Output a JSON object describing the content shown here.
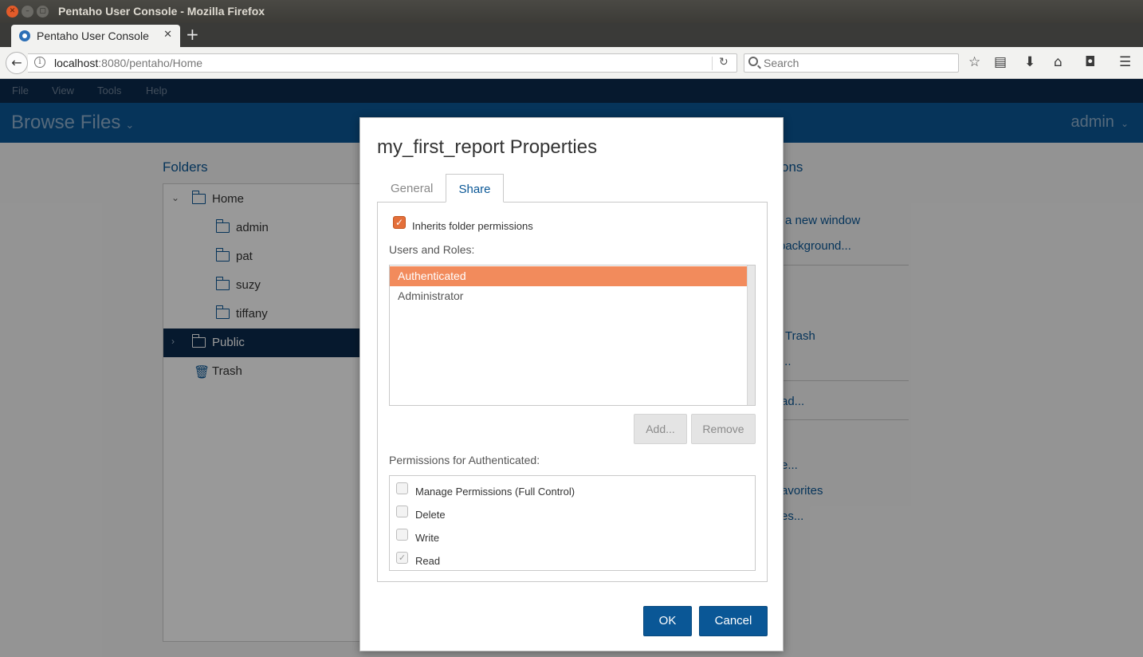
{
  "window": {
    "title": "Pentaho User Console - Mozilla Firefox",
    "close_glyph": "✕",
    "min_glyph": "–",
    "max_glyph": "▢"
  },
  "browser": {
    "tab_title": "Pentaho User Console",
    "tab_close": "✕",
    "new_tab": "+",
    "url_host": "localhost",
    "url_rest": ":8080/pentaho/Home",
    "search_placeholder": "Search",
    "back_glyph": "←",
    "reload_glyph": "↻",
    "info_glyph": "i",
    "toolbar_icons": {
      "bookmark": "☆",
      "reading_list": "▤",
      "download": "⬇",
      "home": "⌂",
      "pocket": "◘",
      "menu": "☰"
    }
  },
  "app": {
    "menu": [
      "File",
      "View",
      "Tools",
      "Help"
    ],
    "perspective": "Browse Files",
    "chevron": "⌄",
    "user": "admin"
  },
  "folders": {
    "title": "Folders",
    "items": [
      {
        "label": "Home",
        "toggle": "⌄"
      },
      {
        "label": "admin"
      },
      {
        "label": "pat"
      },
      {
        "label": "suzy"
      },
      {
        "label": "tiffany"
      },
      {
        "label": "Public",
        "toggle": "›"
      },
      {
        "label": "Trash",
        "icon": "🗑"
      }
    ]
  },
  "actions_bg": {
    "title": "ons",
    "links": [
      "a new window",
      "background...",
      "Trash",
      "...",
      "ad...",
      "e...",
      "avorites",
      "es..."
    ]
  },
  "dialog": {
    "title": "my_first_report Properties",
    "tabs": [
      "General",
      "Share"
    ],
    "inherit_label": "Inherits folder permissions",
    "inherit_checked": true,
    "check_glyph": "✓",
    "users_label": "Users and Roles:",
    "users": [
      "Authenticated",
      "Administrator"
    ],
    "selected_user": "Authenticated",
    "add_button": "Add...",
    "remove_button": "Remove",
    "permissions_label": "Permissions for Authenticated:",
    "permissions": [
      {
        "label": "Manage Permissions (Full Control)",
        "checked": false
      },
      {
        "label": "Delete",
        "checked": false
      },
      {
        "label": "Write",
        "checked": false
      },
      {
        "label": "Read",
        "checked": true
      }
    ],
    "ok_button": "OK",
    "cancel_button": "Cancel"
  },
  "colors": {
    "accent": "#0a5796",
    "selected_row": "#f28b5c",
    "header_dark": "#0b2b4d"
  }
}
